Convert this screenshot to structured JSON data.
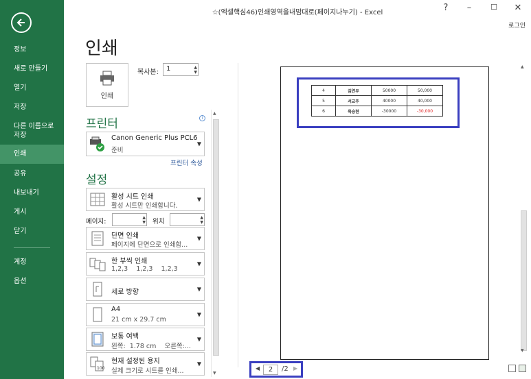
{
  "window": {
    "title": "☆(엑셀핵심46)인쇄영역을내맘대로(페이지나누기) - Excel",
    "login": "로그인"
  },
  "sidebar": {
    "items": [
      "정보",
      "새로 만들기",
      "열기",
      "저장",
      "다른 이름으로 저장",
      "인쇄",
      "공유",
      "내보내기",
      "게시",
      "닫기",
      "계정",
      "옵션"
    ],
    "active": "인쇄"
  },
  "print": {
    "page_title": "인쇄",
    "print_button": "인쇄",
    "copies_label": "복사본:",
    "copies_value": "1"
  },
  "printer": {
    "heading": "프린터",
    "name": "Canon Generic Plus PCL6",
    "status": "준비",
    "properties_link": "프린터 속성"
  },
  "settings": {
    "heading": "설정",
    "scope": {
      "title": "활성 시트 인쇄",
      "desc": "활성 시트만 인쇄합니다."
    },
    "pages_label": "페이지:",
    "to_label": "위치",
    "sides": {
      "title": "단면 인쇄",
      "desc": "페이지에 단면으로 인쇄합..."
    },
    "collate": {
      "title": "한 부씩 인쇄",
      "desc": "1,2,3    1,2,3    1,2,3"
    },
    "orientation": {
      "title": "세로 방향"
    },
    "paper": {
      "title": "A4",
      "desc": "21 cm x 29.7 cm"
    },
    "margins": {
      "title": "보통 여백",
      "desc": "왼쪽:  1.78 cm    오른쪽:..."
    },
    "scaling": {
      "title": "현재 설정된 용지",
      "desc": "실제 크기로 시트를 인쇄..."
    }
  },
  "preview": {
    "rows": [
      {
        "no": "4",
        "name": "김연우",
        "v1": "50000",
        "v2": "50,000",
        "neg": false
      },
      {
        "no": "5",
        "name": "서교주",
        "v1": "40000",
        "v2": "40,000",
        "neg": false
      },
      {
        "no": "6",
        "name": "육승현",
        "v1": "-30000",
        "v2": "-30,000",
        "neg": true
      }
    ],
    "current_page": "2",
    "total_pages": "/2"
  },
  "colors": {
    "accent": "#217346",
    "highlight": "#3a3fc0",
    "negative": "#e02020"
  }
}
